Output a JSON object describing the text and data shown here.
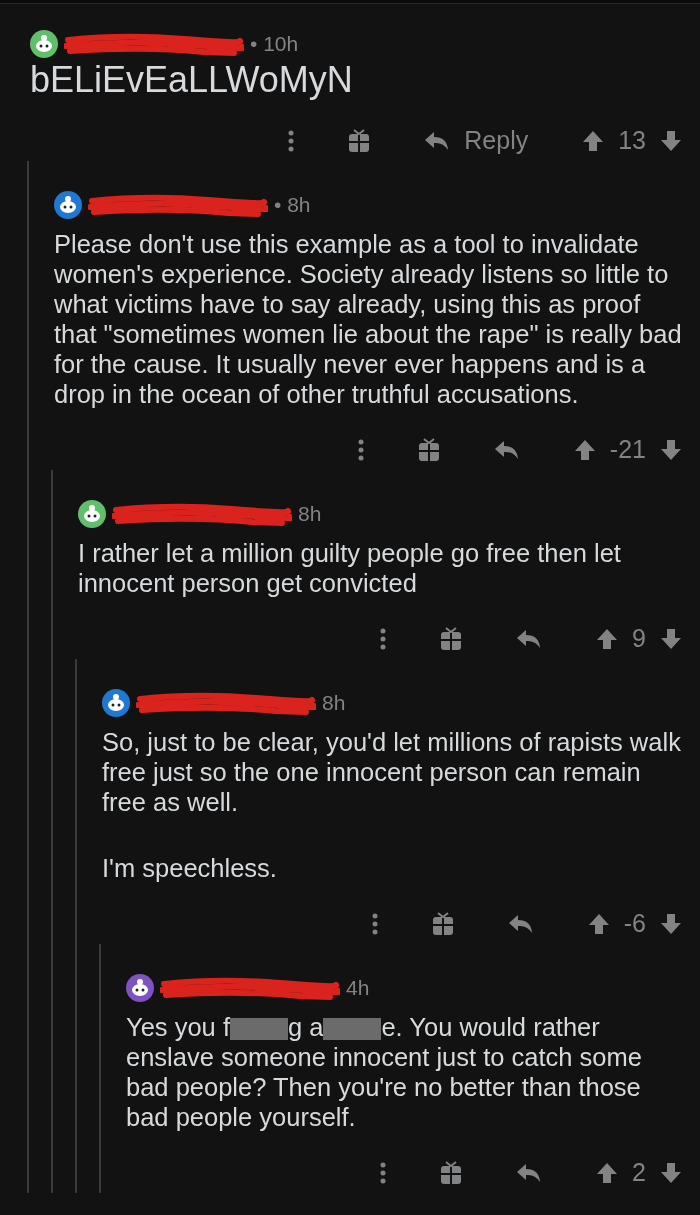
{
  "comments": [
    {
      "avatar": {
        "color": "#5fbf6a"
      },
      "redacted_name": true,
      "time": "• 10h",
      "paragraphs": [
        [
          "bELiEvEaLLWoMyN"
        ]
      ],
      "reply_label": "Reply",
      "score": "13",
      "children": [
        {
          "avatar": {
            "color": "#1f78d1"
          },
          "redacted_name": true,
          "time": "• 8h",
          "paragraphs": [
            [
              "Please don't use this example as a tool to invalidate women's experience. Society already listens so little to what victims have to say already, using this as proof that \"sometimes women lie about the rape\" is really bad for the cause. It usually never ever happens and is a drop in the ocean of other truthful accusations."
            ]
          ],
          "score": "-21",
          "children": [
            {
              "avatar": {
                "color": "#5fbf6a"
              },
              "redacted_name": true,
              "time": "8h",
              "paragraphs": [
                [
                  "I rather let a million guilty people go free then let innocent person get convicted"
                ]
              ],
              "score": "9",
              "children": [
                {
                  "avatar": {
                    "color": "#1f78d1"
                  },
                  "redacted_name": true,
                  "time": "8h",
                  "paragraphs": [
                    [
                      "So, just to be clear, you'd let millions of rapists walk free just so the one innocent person can remain free as well."
                    ],
                    [
                      "I'm speechless."
                    ]
                  ],
                  "score": "-6",
                  "children": [
                    {
                      "avatar": {
                        "color": "#7e53c1"
                      },
                      "redacted_name": true,
                      "time": "4h",
                      "paragraphs": [
                        [
                          "Yes you f",
                          "g a",
                          "e. You would rather enslave someone innocent just to catch some bad people? Then you're no better than those bad people yourself."
                        ]
                      ],
                      "score": "2"
                    }
                  ]
                }
              ]
            }
          ]
        }
      ]
    }
  ]
}
